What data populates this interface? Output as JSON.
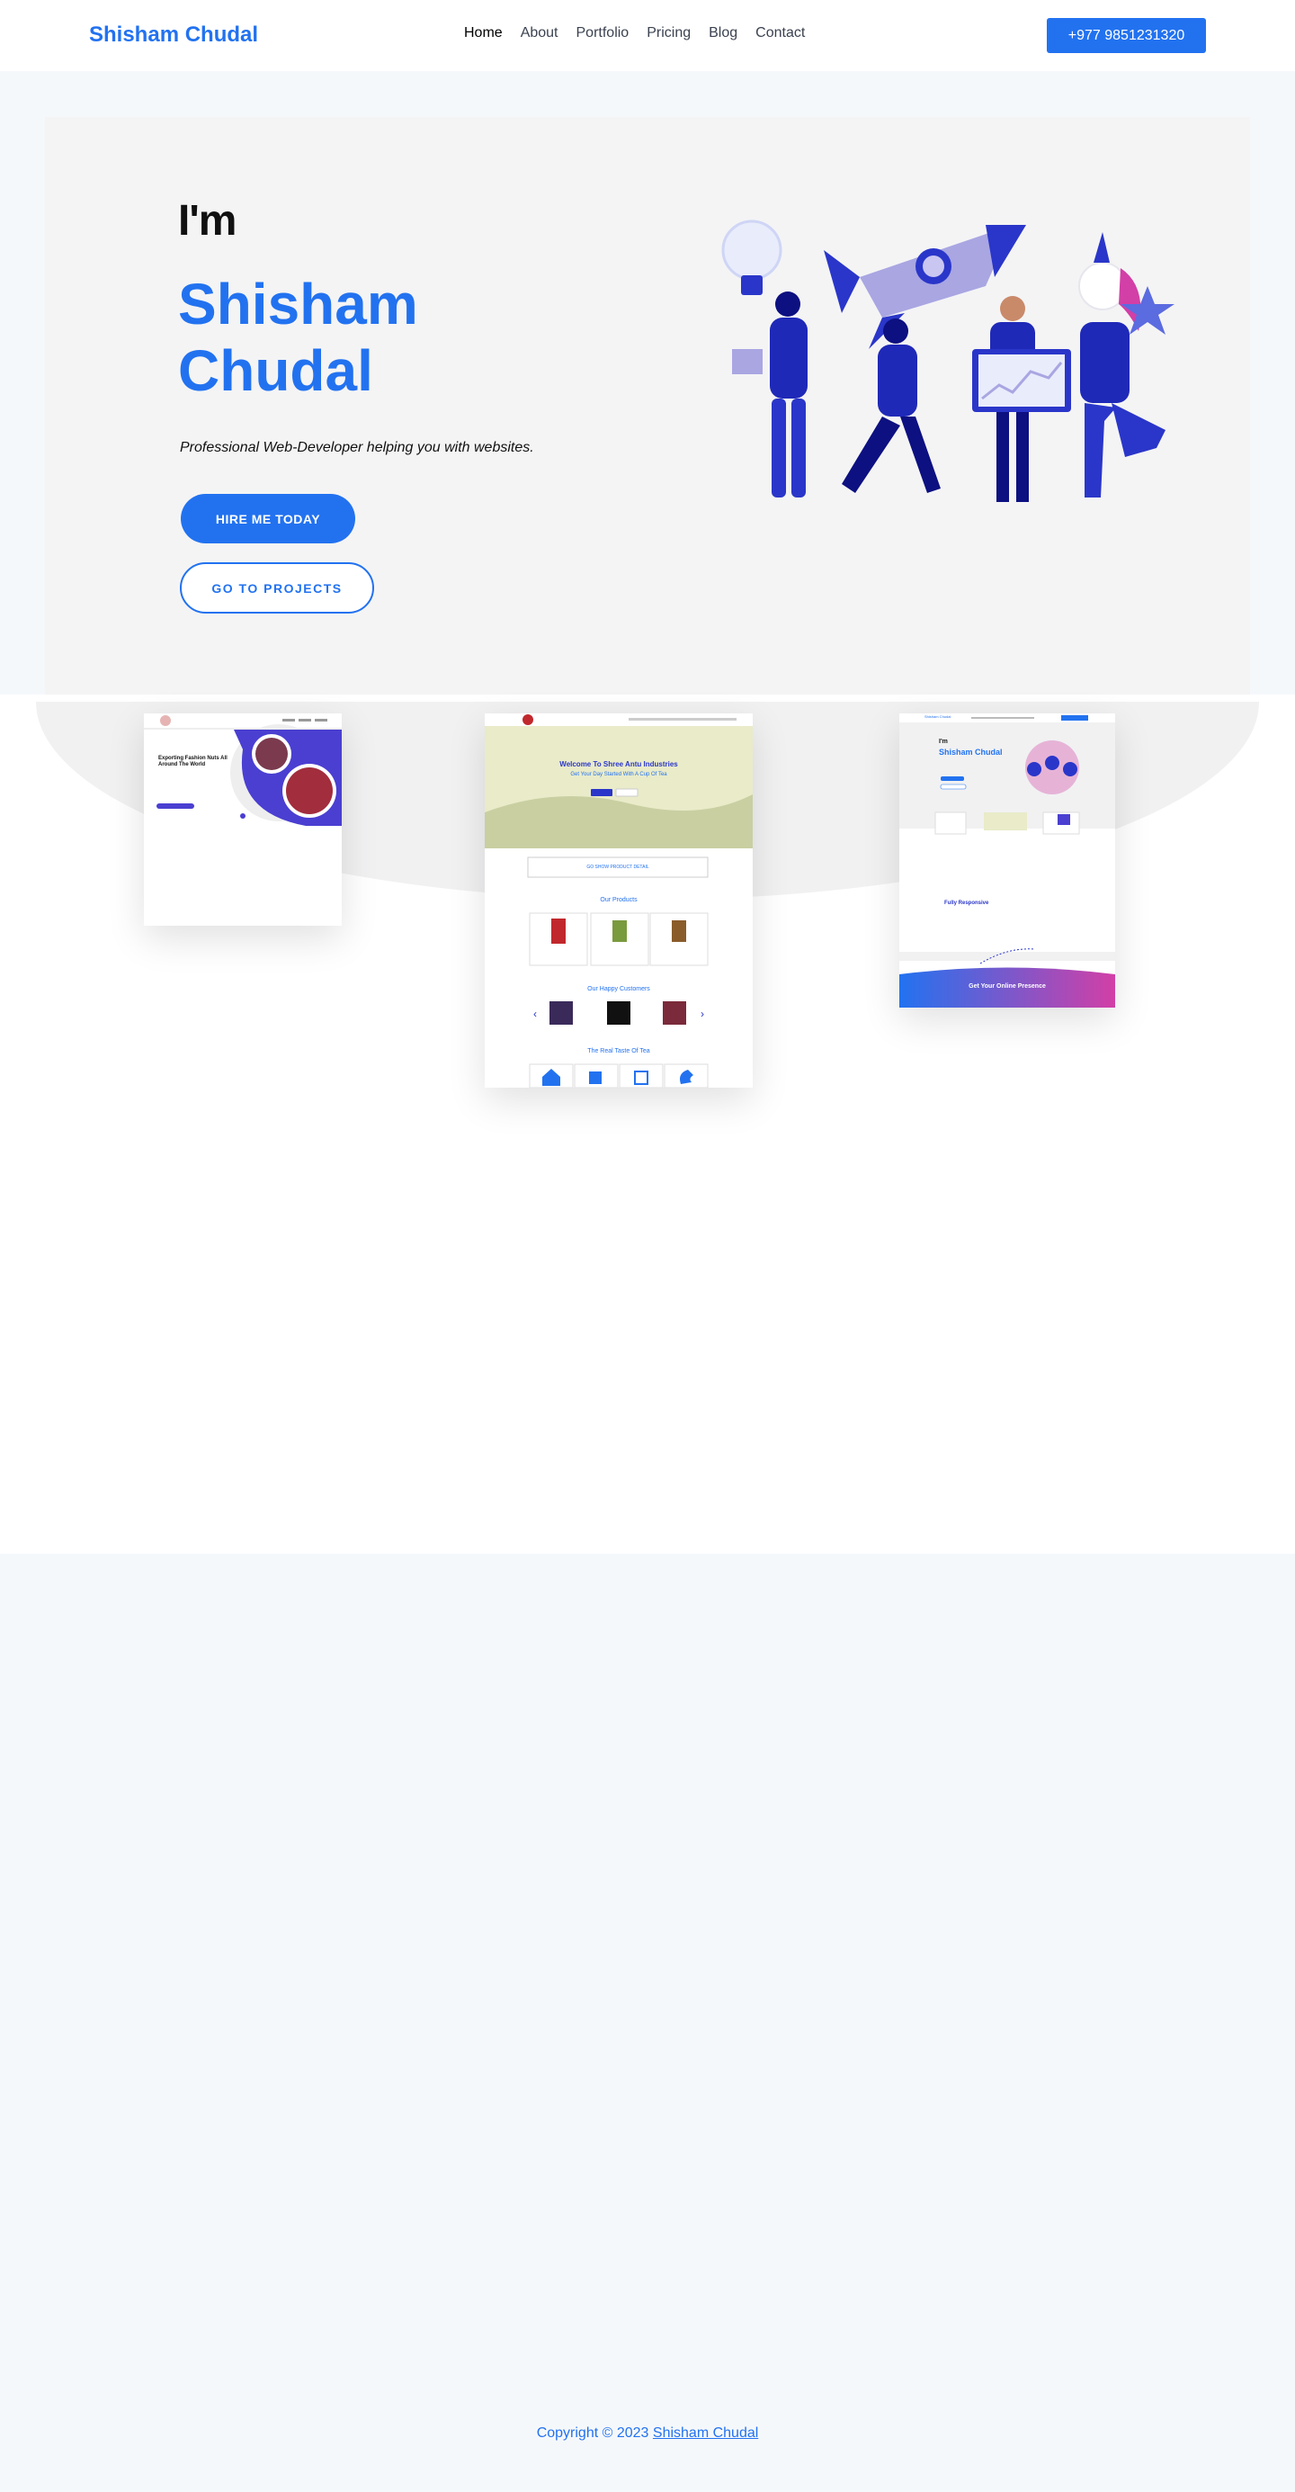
{
  "header": {
    "logo": "Shisham Chudal",
    "nav": [
      {
        "label": "Home",
        "active": true
      },
      {
        "label": "About"
      },
      {
        "label": "Portfolio"
      },
      {
        "label": "Pricing"
      },
      {
        "label": "Blog"
      },
      {
        "label": "Contact"
      }
    ],
    "phone": "+977 9851231320"
  },
  "hero": {
    "intro": "I'm",
    "name_line1": "Shisham",
    "name_line2": "Chudal",
    "tagline": "Professional Web-Developer helping you with websites.",
    "hire_button": "HIRE ME TODAY",
    "projects_button": "GO TO PROJECTS"
  },
  "portfolio": {
    "card1": {
      "heading": "Exporting Fashion Nuts All Around The World"
    },
    "card2": {
      "heading": "Welcome To Shree Antu Industries",
      "subheading": "Get Your Day Started With A Cup Of Tea",
      "cta": "GO SHOW PRODUCT DETAIL",
      "products_title": "Our Products",
      "customers_title": "Our Happy Customers",
      "taste_title": "The Real Taste Of Tea"
    },
    "card3": {
      "brand": "Shisham Chudal",
      "im": "I'm",
      "name": "Shisham Chudal",
      "feature_title": "Fully Responsive",
      "banner": "Get Your Online Presence"
    }
  },
  "footer": {
    "prefix": "Copyright © 2023 ",
    "link": "Shisham Chudal"
  },
  "colors": {
    "accent": "#2272f0",
    "illustration_blue": "#2a36c9",
    "illustration_pink": "#d23fa6"
  }
}
